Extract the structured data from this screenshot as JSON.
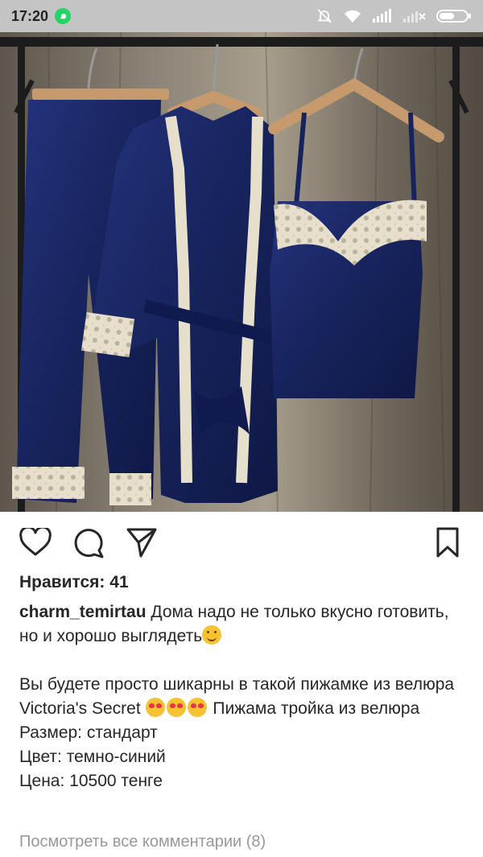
{
  "status": {
    "time": "17:20",
    "icons": [
      "whatsapp-icon",
      "silent-icon",
      "wifi-icon",
      "signal-icon",
      "no-signal-icon",
      "battery-icon"
    ]
  },
  "post": {
    "image_description_icon": "pajama-photo",
    "likes": "Нравится: 41",
    "username": "charm_temirtau",
    "caption_line1": " Дома надо не только вкусно готовить, но и хорошо выглядеть",
    "caption_para2": "Вы будете просто шикарны в такой пижамке из велюра Victoria's Secret ",
    "caption_para2_tail": " Пижама тройка из велюра",
    "size": "Размер: стандарт",
    "color": "Цвет: темно-синий",
    "price": "Цена: 10500 тенге",
    "view_comments": "Посмотреть все комментарии (8)"
  },
  "actions": {
    "icons": [
      "heart-icon",
      "comment-icon",
      "share-icon",
      "bookmark-icon"
    ]
  },
  "colors": {
    "status_bar": "#c4c4c4",
    "text": "#262626",
    "muted": "#999999",
    "velvet": "#1b2a6b",
    "lace": "#e8e1cf"
  }
}
